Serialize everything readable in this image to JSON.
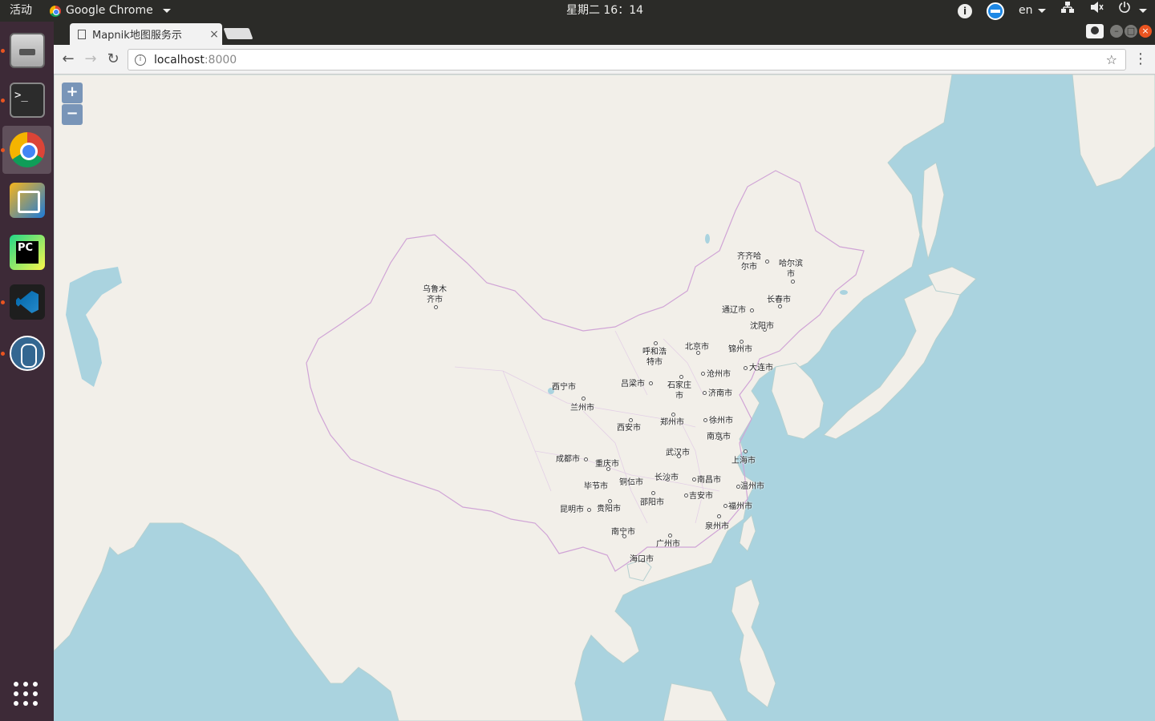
{
  "topbar": {
    "activities": "活动",
    "app_name": "Google Chrome",
    "clock": "星期二 16：14",
    "lang": "en"
  },
  "launcher": {
    "items": [
      {
        "name": "files"
      },
      {
        "name": "terminal"
      },
      {
        "name": "chrome",
        "active": true
      },
      {
        "name": "virtualbox"
      },
      {
        "name": "pycharm",
        "label": "PC"
      },
      {
        "name": "vscode"
      },
      {
        "name": "postgresql"
      }
    ]
  },
  "browser": {
    "tab_title": "Mapnik地图服务示",
    "tab_close": "×",
    "url_host": "localhost",
    "url_port": ":8000"
  },
  "map": {
    "zoom_in": "+",
    "zoom_out": "−",
    "cities": [
      {
        "name": "乌鲁木\n齐市"
      },
      {
        "name": "齐齐哈\n尔市"
      },
      {
        "name": "哈尔滨\n市"
      },
      {
        "name": "长春市"
      },
      {
        "name": "通辽市"
      },
      {
        "name": "沈阳市"
      },
      {
        "name": "北京市"
      },
      {
        "name": "锦州市"
      },
      {
        "name": "呼和浩\n特市"
      },
      {
        "name": "大连市"
      },
      {
        "name": "沧州市"
      },
      {
        "name": "石家庄\n市"
      },
      {
        "name": "吕梁市"
      },
      {
        "name": "济南市"
      },
      {
        "name": "西宁市"
      },
      {
        "name": "兰州市"
      },
      {
        "name": "徐州市"
      },
      {
        "name": "郑州市"
      },
      {
        "name": "西安市"
      },
      {
        "name": "南京市"
      },
      {
        "name": "武汉市"
      },
      {
        "name": "上海市"
      },
      {
        "name": "成都市"
      },
      {
        "name": "重庆市"
      },
      {
        "name": "长沙市"
      },
      {
        "name": "南昌市"
      },
      {
        "name": "铜仁市"
      },
      {
        "name": "毕节市"
      },
      {
        "name": "温州市"
      },
      {
        "name": "吉安市"
      },
      {
        "name": "邵阳市"
      },
      {
        "name": "福州市"
      },
      {
        "name": "昆明市"
      },
      {
        "name": "贵阳市"
      },
      {
        "name": "泉州市"
      },
      {
        "name": "南宁市"
      },
      {
        "name": "广州市"
      },
      {
        "name": "海口市"
      }
    ]
  }
}
